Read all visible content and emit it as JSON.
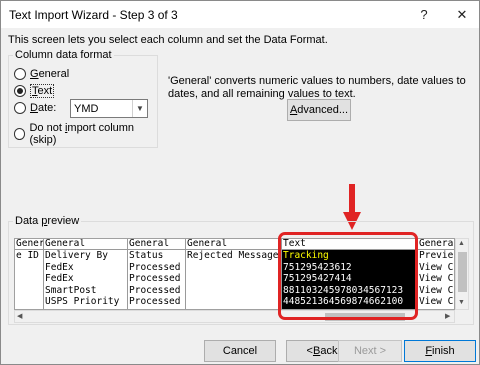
{
  "window": {
    "title": "Text Import Wizard - Step 3 of 3",
    "help_glyph": "?",
    "close_glyph": "✕"
  },
  "instruction": "This screen lets you select each column and set the Data Format.",
  "column_format": {
    "legend": "Column data format",
    "options": [
      {
        "label_pre": "",
        "accel": "G",
        "label_post": "eneral",
        "checked": false
      },
      {
        "label_pre": "",
        "accel": "T",
        "label_post": "ext",
        "checked": true
      },
      {
        "label_pre": "",
        "accel": "D",
        "label_post": "ate:",
        "checked": false
      },
      {
        "label_pre": "Do not ",
        "accel": "i",
        "label_post": "mport column (skip)",
        "checked": false
      }
    ],
    "date_format": "YMD"
  },
  "description": "'General' converts numeric values to numbers, date values to dates, and all remaining values to text.",
  "advanced_button": {
    "accel": "A",
    "rest": "dvanced..."
  },
  "preview": {
    "legend_pre": "Data ",
    "legend_accel": "p",
    "legend_post": "review",
    "selected_column_index": 4,
    "columns": [
      {
        "header": "Gener",
        "cells": [
          "e ID",
          "",
          "",
          "",
          ""
        ]
      },
      {
        "header": "General",
        "cells": [
          "Delivery By",
          "FedEx",
          "FedEx",
          "SmartPost",
          "USPS Priority"
        ]
      },
      {
        "header": "General",
        "cells": [
          "Status",
          "Processed",
          "Processed",
          "Processed",
          "Processed"
        ]
      },
      {
        "header": "General",
        "cells": [
          "Rejected Message",
          "",
          "",
          "",
          ""
        ]
      },
      {
        "header": "Text",
        "cells": [
          "Tracking",
          "751295423612",
          "751295427414",
          "881103245978034567123",
          "448521364569874662100"
        ]
      },
      {
        "header": "Genera",
        "cells": [
          "Previe",
          "View C",
          "View C",
          "View C",
          "View C"
        ]
      }
    ]
  },
  "buttons": {
    "cancel": "Cancel",
    "back": {
      "pre": "< ",
      "accel": "B",
      "rest": "ack"
    },
    "next": "Next >",
    "finish": {
      "accel": "F",
      "rest": "inish"
    }
  },
  "colors": {
    "highlight": "#e02424",
    "selected_bg": "#000000",
    "selected_first_row": "#ffff00"
  }
}
